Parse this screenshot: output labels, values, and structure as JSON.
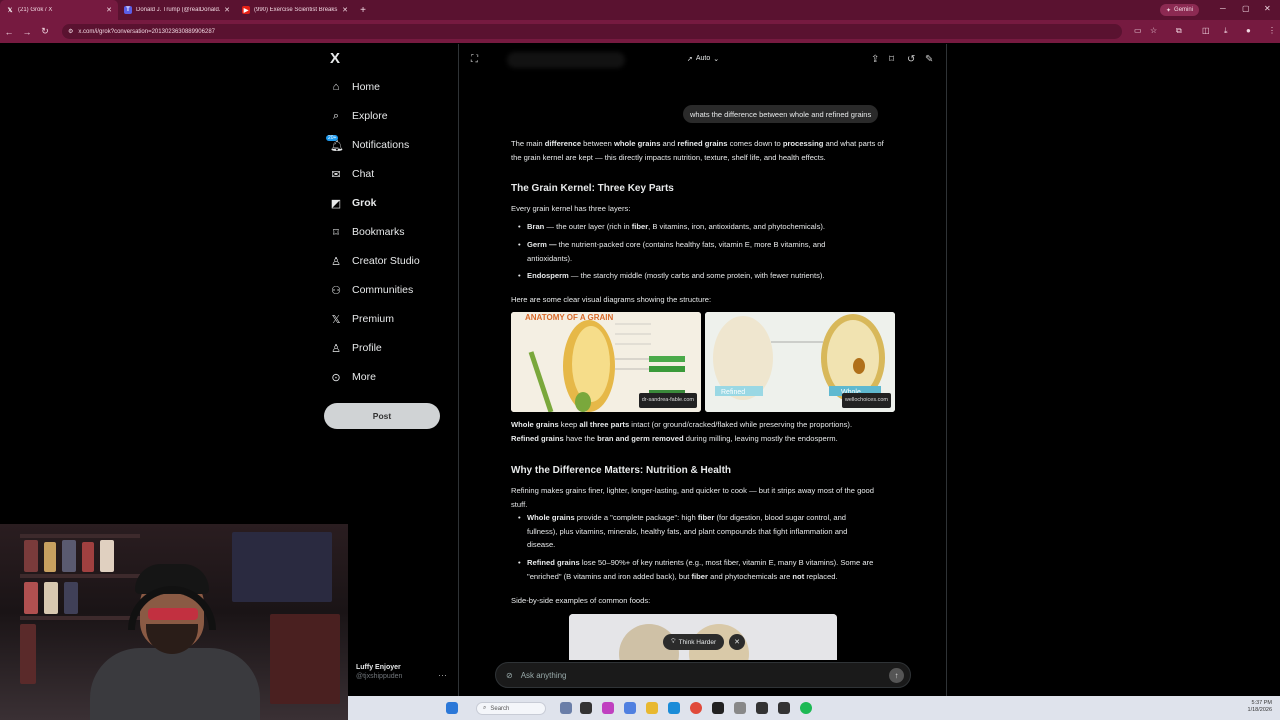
{
  "browser": {
    "tabs": [
      {
        "title": "(21) Grok / X",
        "icon": "x-logo-icon"
      },
      {
        "title": "Donald J. Trump (@realDonald...",
        "icon": "truth-social-icon"
      },
      {
        "title": "(990) Exercise Scientist Breaks I...",
        "icon": "youtube-icon"
      }
    ],
    "gemini_label": "Gemini",
    "url": "x.com/i/grok?conversation=2013023630889906287"
  },
  "sidebar": {
    "logo": "X",
    "items": [
      {
        "label": "Home",
        "icon": "home-icon"
      },
      {
        "label": "Explore",
        "icon": "search-icon"
      },
      {
        "label": "Notifications",
        "icon": "bell-icon",
        "badge": "20+"
      },
      {
        "label": "Chat",
        "icon": "mail-icon"
      },
      {
        "label": "Grok",
        "icon": "grok-icon"
      },
      {
        "label": "Bookmarks",
        "icon": "bookmark-icon"
      },
      {
        "label": "Creator Studio",
        "icon": "person-icon"
      },
      {
        "label": "Communities",
        "icon": "communities-icon"
      },
      {
        "label": "Premium",
        "icon": "x-logo-icon"
      },
      {
        "label": "Profile",
        "icon": "person-icon"
      },
      {
        "label": "More",
        "icon": "more-circle-icon"
      }
    ],
    "post_label": "Post",
    "account": {
      "name": "Luffy Enjoyer",
      "handle": "@tjxshippuden"
    }
  },
  "grok": {
    "mode": "Auto",
    "user_question": "whats the difference between whole and refined grains",
    "intro": {
      "a": "The main ",
      "b": "difference",
      "c": " between ",
      "d": "whole grains",
      "e": " and ",
      "f": "refined grains",
      "g": " comes down to ",
      "h": "processing",
      "i": " and what parts of the grain kernel are kept — this directly impacts nutrition, texture, shelf life, and health effects."
    },
    "h1": "The Grain Kernel: Three Key Parts",
    "layers_intro": "Every grain kernel has three layers:",
    "bran": {
      "name": "Bran",
      "a": " — the outer layer (rich in ",
      "b": "fiber",
      "c": ", B vitamins, iron, antioxidants, and phytochemicals)."
    },
    "germ": {
      "name": "Germ —",
      "a": " the nutrient-packed core (contains healthy fats, vitamin E, more B vitamins, and antioxidants)."
    },
    "endo": {
      "name": "Endosperm",
      "a": " — the starchy middle (mostly carbs and some protein, with fewer nutrients)."
    },
    "diagrams_intro": "Here are some clear visual diagrams showing the structure:",
    "img1": {
      "title": "ANATOMY OF A GRAIN",
      "source": "dr-sandrea-fable.com"
    },
    "img2": {
      "label_refined": "Refined",
      "label_whole": "Whole",
      "source": "wellochoices.com"
    },
    "whole_line": {
      "a": "Whole grains",
      "b": " keep ",
      "c": "all three parts",
      "d": " intact (or ground/cracked/flaked while preserving the proportions)."
    },
    "refined_line": {
      "a": "Refined grains",
      "b": " have the ",
      "c": "bran and germ removed",
      "d": " during milling, leaving mostly the endosperm."
    },
    "h2": "Why the Difference Matters: Nutrition & Health",
    "refining": "Refining makes grains finer, lighter, longer-lasting, and quicker to cook — but it strips away most of the good stuff.",
    "bullet_whole": {
      "a": "Whole grains",
      "b": " provide a \"complete package\": high ",
      "c": "fiber",
      "d": " (for digestion, blood sugar control, and fullness), plus vitamins, minerals, healthy fats, and plant compounds that fight inflammation and disease."
    },
    "bullet_refined": {
      "a": "Refined grains",
      "b": " lose 50–90%+ of key nutrients (e.g., most fiber, vitamin E, many B vitamins). Some are \"enriched\" (B vitamins and iron added back), but ",
      "c": "fiber",
      "d": " and phytochemicals are ",
      "e": "not",
      "f": " replaced."
    },
    "foods_intro": "Side-by-side examples of common foods:",
    "think_harder": "Think Harder",
    "ask_placeholder": "Ask anything"
  },
  "taskbar": {
    "search_placeholder": "Search",
    "time": "5:37 PM",
    "date": "1/18/2026"
  }
}
